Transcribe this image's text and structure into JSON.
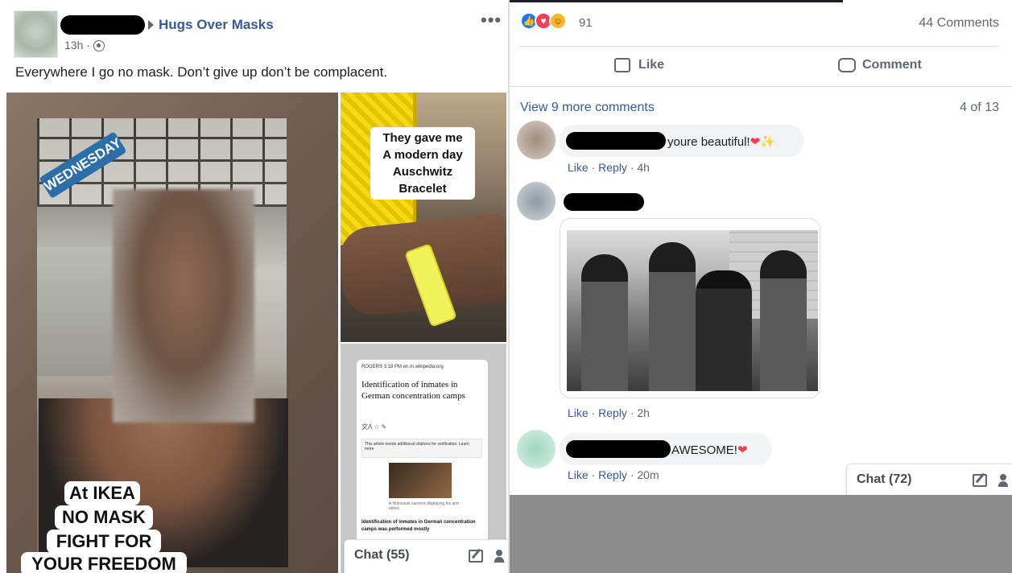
{
  "post": {
    "group_name": "Hugs Over Masks",
    "time": "13h",
    "dot": "·",
    "more_label": "•••",
    "text": "Everywhere I go no mask. Don’t give up don’t be complacent."
  },
  "main_image": {
    "badge": "WEDNESDAY",
    "caption_lines": [
      "At IKEA",
      "NO MASK",
      "FIGHT FOR",
      "YOUR FREEDOM"
    ]
  },
  "thumb_top": {
    "caption_lines": [
      "They gave me",
      "A modern day",
      "Auschwitz",
      "Bracelet"
    ]
  },
  "thumb_bottom": {
    "status": "ROGERS        3:18 PM        en.m.wikipedia.org",
    "title": "Identification of inmates in German concentration camps",
    "tools": "文A                              ☆  ✎",
    "notice": "This article needs additional citations for verification.   Learn more",
    "image_caption": "A Holocaust survivor displaying his arm tattoo.",
    "body_text": "Identification of inmates in German concentration camps was performed mostly"
  },
  "chat_left": {
    "label": "Chat (55)"
  },
  "chat_right": {
    "label": "Chat (72)"
  },
  "reactions": {
    "count": "91",
    "comments": "44 Comments"
  },
  "actions": {
    "like": "Like",
    "comment": "Comment"
  },
  "comments_meta": {
    "view_more": "View 9 more comments",
    "counter": "4 of 13"
  },
  "comments": [
    {
      "text": "youre beautiful!",
      "emoji": "❤✨",
      "like": "Like",
      "reply": "Reply",
      "time": "4h"
    },
    {
      "text": "",
      "like": "Like",
      "reply": "Reply",
      "time": "2h"
    },
    {
      "text": "AWESOME!",
      "emoji": "❤",
      "like": "Like",
      "reply": "Reply",
      "time": "20m"
    }
  ]
}
